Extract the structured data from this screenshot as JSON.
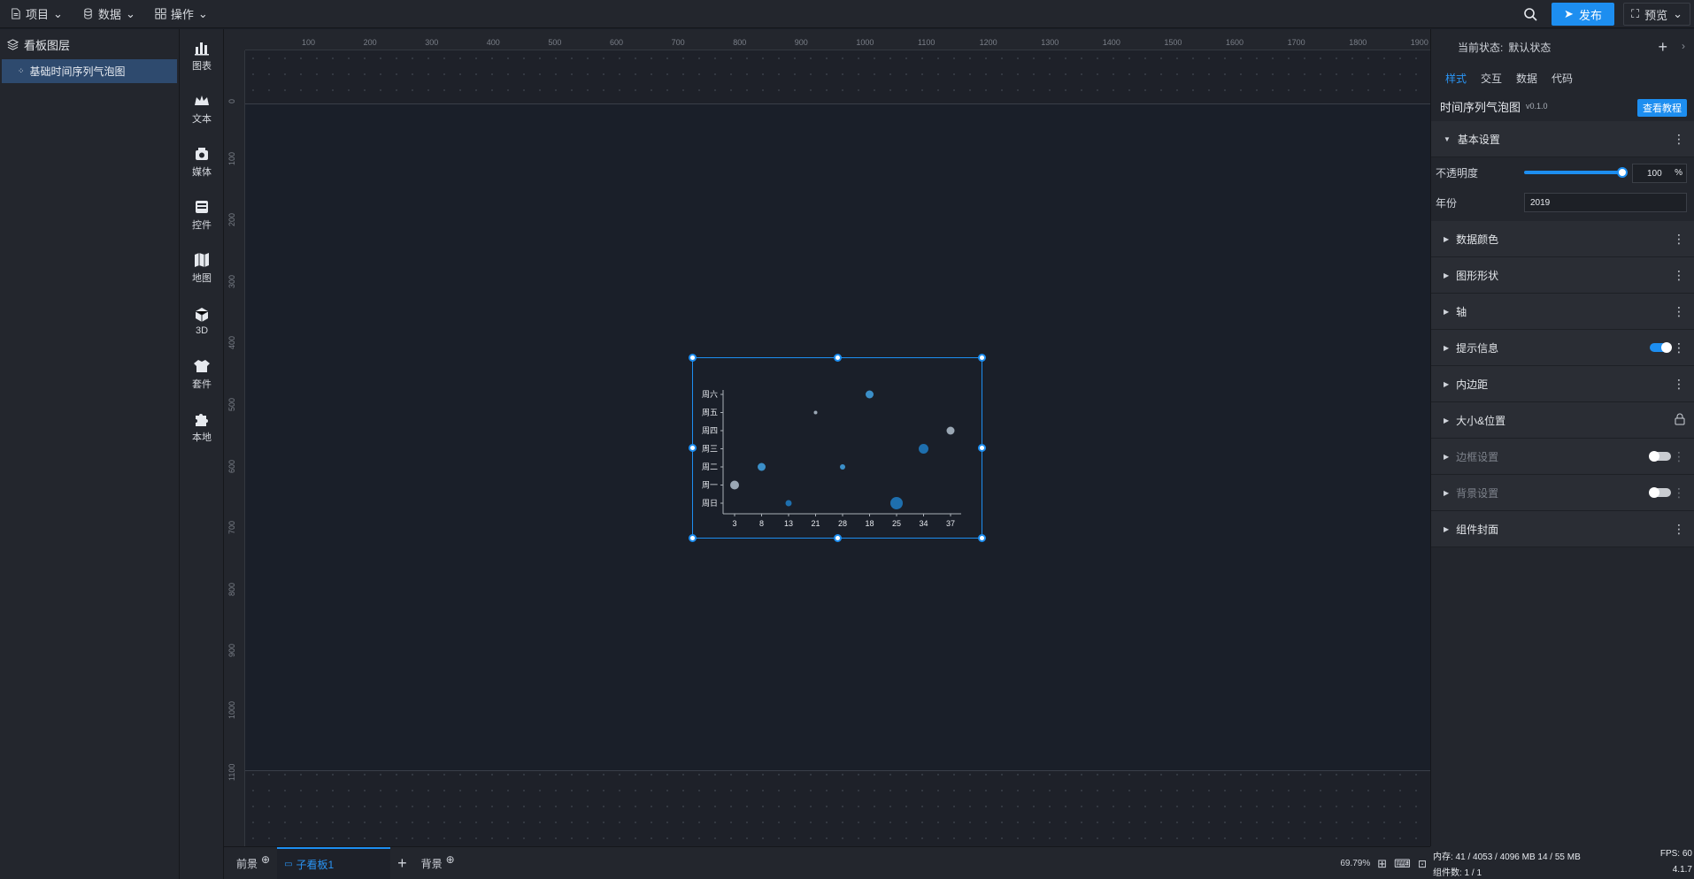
{
  "topbar": {
    "menus": [
      {
        "label": "项目",
        "icon": "file-icon"
      },
      {
        "label": "数据",
        "icon": "database-icon"
      },
      {
        "label": "操作",
        "icon": "grid-icon"
      }
    ],
    "publish_label": "发布",
    "preview_label": "预览"
  },
  "layers": {
    "title": "看板图层",
    "items": [
      {
        "label": "基础时间序列气泡图"
      }
    ]
  },
  "tools": [
    {
      "label": "图表",
      "icon": "bar-chart-icon"
    },
    {
      "label": "文本",
      "icon": "crown-text-icon"
    },
    {
      "label": "媒体",
      "icon": "media-icon"
    },
    {
      "label": "控件",
      "icon": "widget-icon"
    },
    {
      "label": "地图",
      "icon": "map-icon"
    },
    {
      "label": "3D",
      "icon": "cube-icon"
    },
    {
      "label": "套件",
      "icon": "shirt-icon"
    },
    {
      "label": "本地",
      "icon": "puzzle-icon"
    }
  ],
  "ruler": {
    "h_ticks": [
      "100",
      "200",
      "300",
      "400",
      "500",
      "600",
      "700",
      "800",
      "900",
      "1000",
      "1100",
      "1200",
      "1300",
      "1400",
      "1500",
      "1600",
      "1700",
      "1800",
      "1900"
    ],
    "v_ticks": [
      "0",
      "100",
      "200",
      "300",
      "400",
      "500",
      "600",
      "700",
      "800",
      "900",
      "1000",
      "1100"
    ]
  },
  "bottombar": {
    "tabs": [
      {
        "label": "前景"
      },
      {
        "label": "子看板1"
      },
      {
        "label": "背景"
      }
    ],
    "zoom": "69.79%"
  },
  "props": {
    "state_label": "当前状态:",
    "state_value": "默认状态",
    "tabs": [
      "样式",
      "交互",
      "数据",
      "代码"
    ],
    "component_title": "时间序列气泡图",
    "version": "v0.1.0",
    "tutorial_label": "查看教程",
    "sections": [
      {
        "label": "基本设置",
        "expanded": true
      },
      {
        "label": "数据颜色"
      },
      {
        "label": "图形形状"
      },
      {
        "label": "轴"
      },
      {
        "label": "提示信息",
        "toggle": "on"
      },
      {
        "label": "内边距"
      },
      {
        "label": "大小&位置",
        "lock": true
      },
      {
        "label": "边框设置",
        "toggle": "off",
        "disabled": true
      },
      {
        "label": "背景设置",
        "toggle": "off",
        "disabled": true
      },
      {
        "label": "组件封面"
      }
    ],
    "fields": {
      "opacity_label": "不透明度",
      "opacity_value": "100",
      "opacity_unit": "%",
      "opacity_level": 1.0,
      "year_label": "年份",
      "year_value": "2019"
    }
  },
  "status": {
    "memory": "内存: 41 / 4053 / 4096 MB  14 / 55 MB",
    "components": "组件数: 1 / 1",
    "fps": "FPS: 60",
    "version": "4.1.7"
  },
  "colors": {
    "accent": "#1d8ef0",
    "bubble_dark": "#1e6fae",
    "bubble_mid": "#3b8fc8",
    "bubble_light": "#9aa7b4"
  },
  "chart_data": {
    "type": "scatter",
    "categories_y": [
      "周日",
      "周一",
      "周二",
      "周三",
      "周四",
      "周五",
      "周六"
    ],
    "x_ticks": [
      "3",
      "8",
      "13",
      "21",
      "28",
      "18",
      "25",
      "34",
      "37"
    ],
    "points": [
      {
        "x": "3",
        "y": "周一",
        "size": 8,
        "color": "light"
      },
      {
        "x": "8",
        "y": "周二",
        "size": 7,
        "color": "mid"
      },
      {
        "x": "13",
        "y": "周日",
        "size": 5,
        "color": "dark"
      },
      {
        "x": "21",
        "y": "周五",
        "size": 2,
        "color": "light"
      },
      {
        "x": "28",
        "y": "周二",
        "size": 4,
        "color": "mid"
      },
      {
        "x": "18",
        "y": "周六",
        "size": 7,
        "color": "mid"
      },
      {
        "x": "25",
        "y": "周日",
        "size": 12,
        "color": "dark"
      },
      {
        "x": "34",
        "y": "周三",
        "size": 9,
        "color": "dark"
      },
      {
        "x": "37",
        "y": "周四",
        "size": 7,
        "color": "light"
      }
    ]
  }
}
